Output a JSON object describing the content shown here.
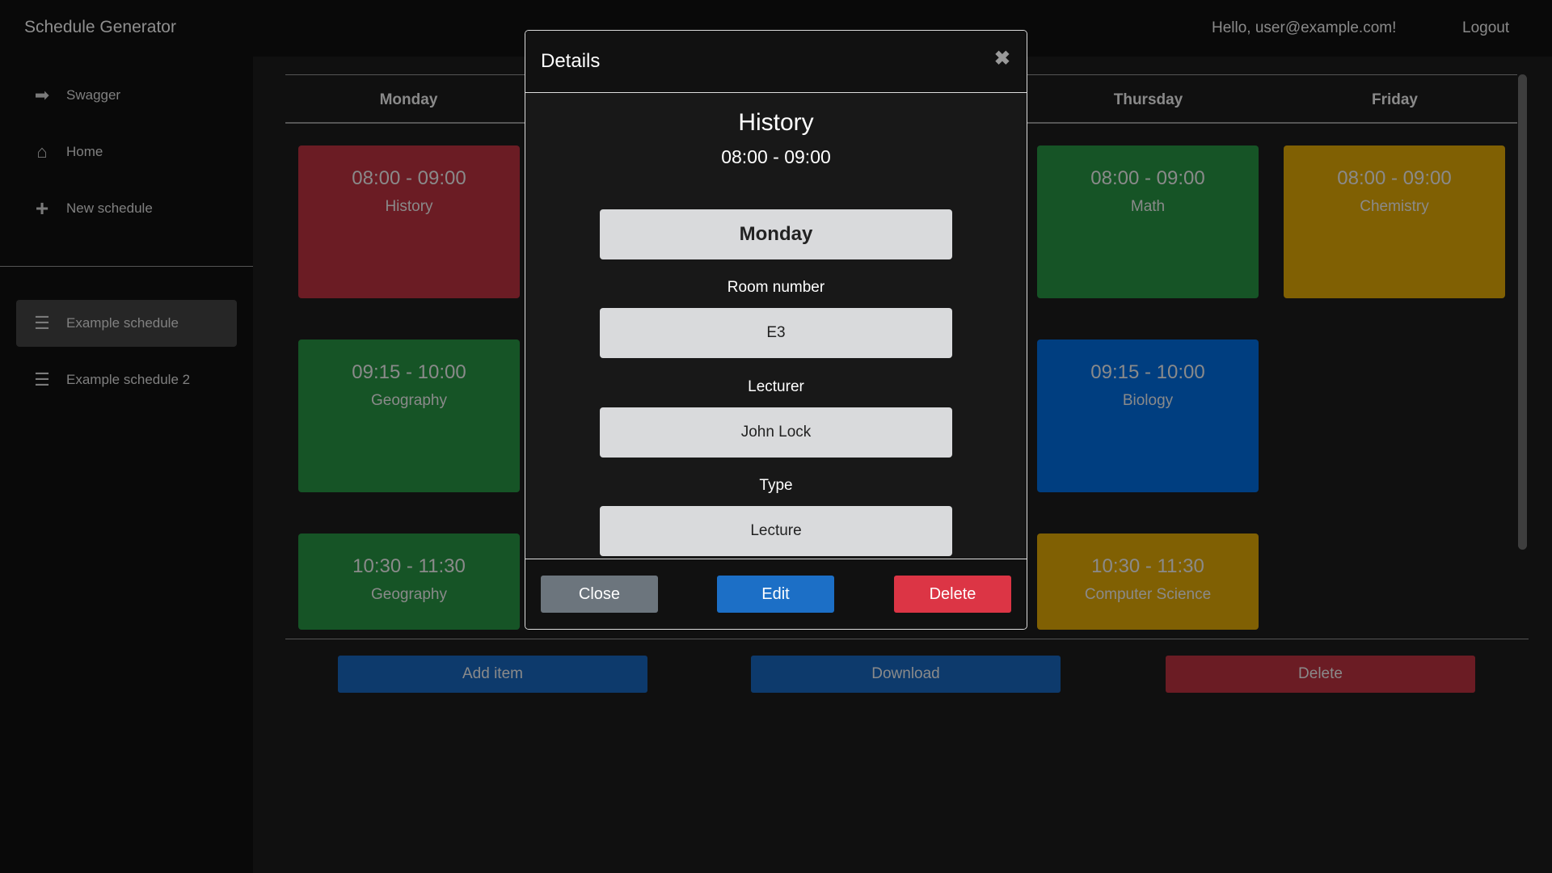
{
  "header": {
    "title": "Schedule Generator",
    "greeting": "Hello, user@example.com!",
    "logout": "Logout"
  },
  "sidebar": {
    "items": [
      {
        "label": "Swagger",
        "icon": "arrow-right-icon"
      },
      {
        "label": "Home",
        "icon": "home-icon"
      },
      {
        "label": "New schedule",
        "icon": "plus-icon"
      }
    ],
    "schedules": [
      {
        "label": "Example schedule",
        "active": true
      },
      {
        "label": "Example schedule 2",
        "active": false
      }
    ]
  },
  "schedule": {
    "days": {
      "monday": "Monday",
      "thursday": "Thursday",
      "friday": "Friday"
    },
    "items": {
      "mon1": {
        "time": "08:00 - 09:00",
        "subject": "History",
        "color": "#6b1c24"
      },
      "mon2": {
        "time": "09:15 - 10:00",
        "subject": "Geography",
        "color": "#165426"
      },
      "mon3": {
        "time": "10:30 - 11:30",
        "subject": "Geography",
        "color": "#165426"
      },
      "thu1": {
        "time": "08:00 - 09:00",
        "subject": "Math",
        "color": "#165426"
      },
      "thu2": {
        "time": "09:15 - 10:00",
        "subject": "Biology",
        "color": "#003e80"
      },
      "thu3": {
        "time": "10:30 - 11:30",
        "subject": "Computer Science",
        "color": "#806003"
      },
      "fri1": {
        "time": "08:00 - 09:00",
        "subject": "Chemistry",
        "color": "#806003"
      }
    }
  },
  "actions": {
    "add": "Add item",
    "download": "Download",
    "delete": "Delete"
  },
  "modal": {
    "title": "Details",
    "subject": "History",
    "time": "08:00 - 09:00",
    "day": "Monday",
    "room_label": "Room number",
    "room": "E3",
    "lecturer_label": "Lecturer",
    "lecturer": "John Lock",
    "type_label": "Type",
    "type": "Lecture",
    "close": "Close",
    "edit": "Edit",
    "delete": "Delete"
  }
}
